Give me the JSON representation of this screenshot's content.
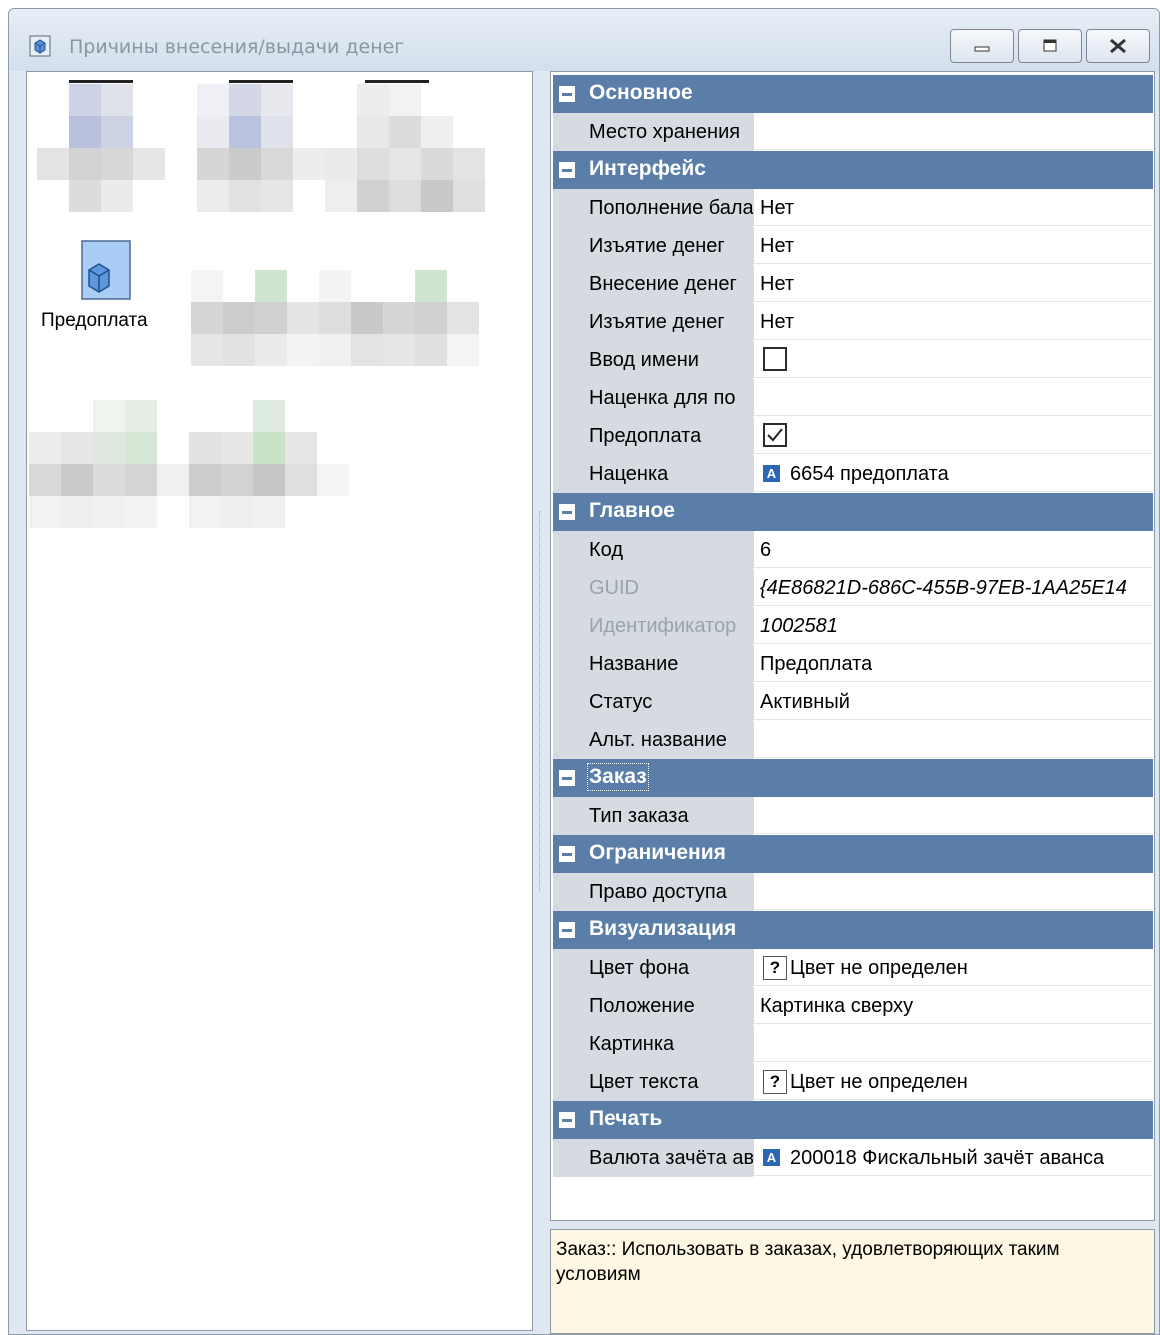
{
  "window": {
    "title": "Причины внесения/выдачи денег",
    "icon": "cube-icon",
    "controls": [
      "minimize-icon",
      "maximize-icon",
      "close-icon"
    ]
  },
  "left_pane": {
    "visible_item_label": "Предоплата",
    "visible_item_icon": "cube-icon"
  },
  "property_grid": {
    "categories": {
      "osnovnoe": "Основное",
      "interface": "Интерфейс",
      "glavnoe": "Главное",
      "zakaz": "Заказ",
      "ogranicheniya": "Ограничения",
      "vizualizatsiya": "Визуализация",
      "pechat": "Печать"
    },
    "rows": {
      "mesto_hraneniya": {
        "name": "Место хранения",
        "value": ""
      },
      "popolnenie": {
        "name": "Пополнение баланса",
        "value": "Нет"
      },
      "izyatie1": {
        "name": "Изъятие денег",
        "value": "Нет"
      },
      "vnesenie": {
        "name": "Внесение денег",
        "value": "Нет"
      },
      "izyatie2": {
        "name": "Изъятие денег",
        "value": "Нет"
      },
      "vvod_imeni": {
        "name": "Ввод имени",
        "checked": false
      },
      "natsenka_dlya": {
        "name": "Наценка для по",
        "value": ""
      },
      "predoplata": {
        "name": "Предоплата",
        "checked": true
      },
      "natsenka": {
        "name": "Наценка",
        "value": "6654 предоплата",
        "badge": "A"
      },
      "kod": {
        "name": "Код",
        "value": "6"
      },
      "guid": {
        "name": "GUID",
        "value": "{4E86821D-686C-455B-97EB-1AA25E14"
      },
      "identifikator": {
        "name": "Идентификатор",
        "value": "1002581"
      },
      "nazvanie": {
        "name": "Название",
        "value": "Предоплата"
      },
      "status": {
        "name": "Статус",
        "value": "Активный"
      },
      "alt_nazvanie": {
        "name": "Альт. название",
        "value": ""
      },
      "tip_zakaza": {
        "name": "Тип заказа",
        "value": ""
      },
      "pravo_dostupa": {
        "name": "Право доступа",
        "value": ""
      },
      "tsvet_fona": {
        "name": "Цвет фона",
        "value": "Цвет не определен",
        "badge": "?"
      },
      "polozhenie": {
        "name": "Положение",
        "value": "Картинка сверху"
      },
      "kartinka": {
        "name": "Картинка",
        "value": ""
      },
      "tsvet_teksta": {
        "name": "Цвет текста",
        "value": "Цвет не определен",
        "badge": "?"
      },
      "valyuta": {
        "name": "Валюта зачёта аванса",
        "value": "200018 Фискальный зачёт аванса",
        "badge": "A"
      }
    }
  },
  "description": "Заказ:: Использовать в заказах, удовлетворяющих таким условиям",
  "colors": {
    "category_header": "#5a7ea8",
    "name_gutter": "#d6dbe1",
    "window_frame": "#dfe8f2",
    "description_bg": "#fdf7e3"
  }
}
